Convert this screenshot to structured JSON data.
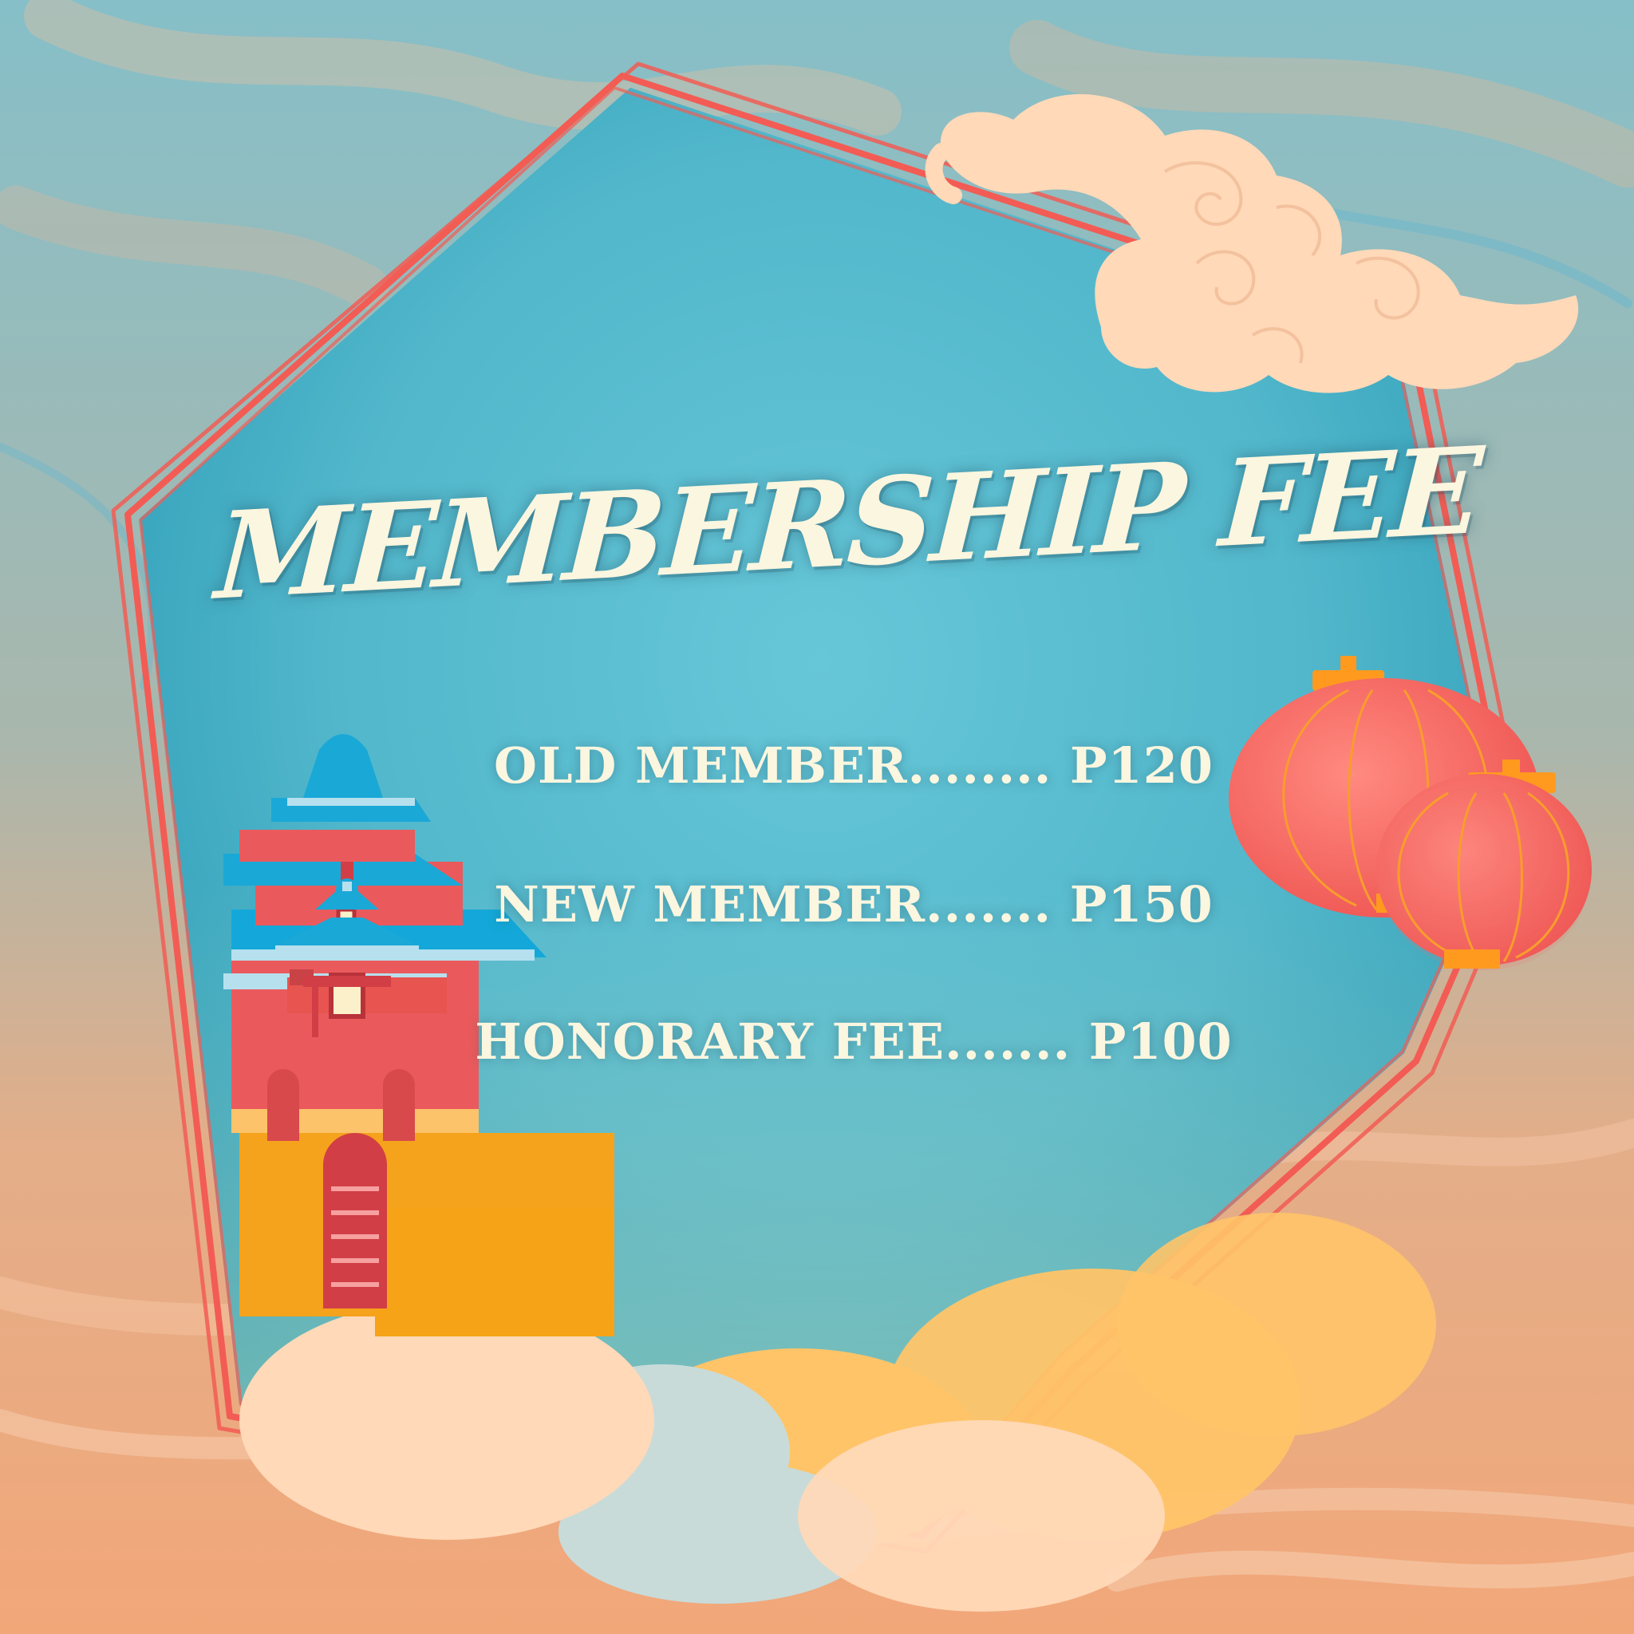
{
  "title": "MEMBERSHIP FEE",
  "fees": [
    {
      "label": "OLD MEMBER........",
      "price": "P120"
    },
    {
      "label": "NEW MEMBER.......",
      "price": "P150"
    },
    {
      "label": "HONORARY FEE.......",
      "price": "P100"
    }
  ],
  "colors": {
    "sky_top": "#86bfc8",
    "sky_bottom": "#f2a779",
    "panel_center": "#66c7d8",
    "panel_edge": "#2598b3",
    "frame": "#f25c54",
    "cloud": "#ffd9b8",
    "lantern": "#f06b6b",
    "lantern_cap": "#ff9a1f",
    "roof": "#1ba6d4",
    "wall": "#f5a21c",
    "text": "#fbf6df"
  },
  "icons": [
    "cloud-icon",
    "lantern-icon",
    "pagoda-icon"
  ]
}
